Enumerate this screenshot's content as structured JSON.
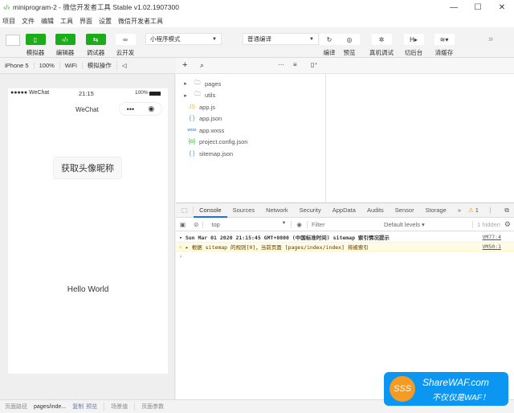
{
  "window": {
    "title": "miniprogram-2 - 微信开发者工具 Stable v1.02.1907300",
    "controls": [
      "—",
      "☐",
      "✕"
    ]
  },
  "menu": [
    "项目",
    "文件",
    "编辑",
    "工具",
    "界面",
    "设置",
    "微信开发者工具"
  ],
  "toolbar": {
    "simulator": "模拟器",
    "editor": "编辑器",
    "debugger": "调试器",
    "cloud": "云开发",
    "mode": "小程序模式",
    "compile_mode": "普通编译",
    "compile": "编译",
    "preview": "预览",
    "remote_debug": "真机调试",
    "background": "切后台",
    "clear_cache": "清缓存",
    "more": "»"
  },
  "device_bar": {
    "device": "iPhone 5",
    "zoom": "100%",
    "network": "WiFi",
    "sim_ops": "模拟操作"
  },
  "phone": {
    "carrier": "●●●●● WeChat",
    "time": "21:15",
    "battery": "100%",
    "nav_title": "WeChat",
    "button": "获取头像昵称",
    "hello": "Hello World"
  },
  "files": [
    {
      "name": "pages",
      "type": "folder"
    },
    {
      "name": "utils",
      "type": "folder"
    },
    {
      "name": "app.js",
      "icon": "JS",
      "color": "#e8b93a"
    },
    {
      "name": "app.json",
      "icon": "{ }",
      "color": "#2a8fd6"
    },
    {
      "name": "app.wxss",
      "icon": "wxss",
      "color": "#2a6fb5"
    },
    {
      "name": "project.config.json",
      "icon": "{o}",
      "color": "#1aad19"
    },
    {
      "name": "sitemap.json",
      "icon": "{ }",
      "color": "#2a8fd6"
    }
  ],
  "devtools": {
    "tabs": [
      "Console",
      "Sources",
      "Network",
      "Security",
      "AppData",
      "Audits",
      "Sensor",
      "Storage"
    ],
    "warn_count": "1",
    "context": "top",
    "filter_placeholder": "Filter",
    "levels": "Default levels ▾",
    "hidden": "1 hidden",
    "logs": [
      {
        "text": "▾ Sun Mar 01 2020 21:15:45 GMT+0800 (中国标准时间) sitemap 索引情况提示",
        "ref": "VM77:4",
        "level": "info"
      },
      {
        "text": "▸ 根据 sitemap 的规则[0]，当前页面 [pages/index/index] 将被索引",
        "ref": "VM50:1",
        "level": "warning"
      }
    ],
    "prompt": "›"
  },
  "statusbar": {
    "path_label": "页面路径",
    "path": "pages/inde...",
    "copy": "复制",
    "preview": "预览",
    "scene": "场景值",
    "params": "页面参数"
  },
  "watermark": {
    "site": "ShareWAF.com",
    "slogan": "不仅仅是WAF！"
  },
  "colors": {
    "accent": "#1aad19",
    "tab_active": "#1a73e8",
    "watermark": "#0b97f1"
  }
}
